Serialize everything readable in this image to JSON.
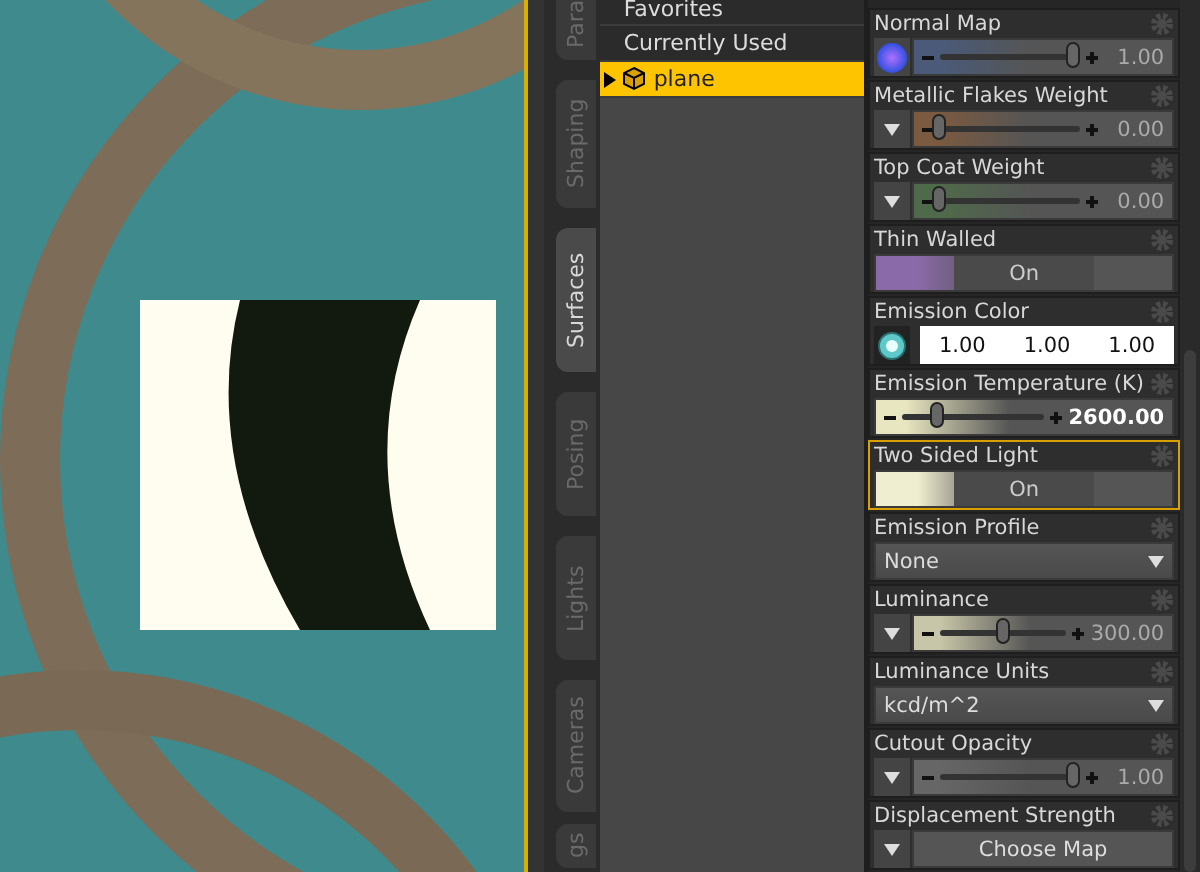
{
  "side_tabs": [
    {
      "label": "Para",
      "selected": false
    },
    {
      "label": "Shaping",
      "selected": false
    },
    {
      "label": "Surfaces",
      "selected": true
    },
    {
      "label": "Posing",
      "selected": false
    },
    {
      "label": "Lights",
      "selected": false
    },
    {
      "label": "Cameras",
      "selected": false
    },
    {
      "label": "gs",
      "selected": false
    }
  ],
  "tree": [
    {
      "kind": "category",
      "label": "Favorites",
      "selected": false
    },
    {
      "kind": "category",
      "label": "Currently Used",
      "selected": false
    },
    {
      "kind": "object",
      "label": "plane",
      "selected": true
    }
  ],
  "properties": [
    {
      "kind": "mapslider",
      "label": "Normal Map",
      "color": "#4a5a78",
      "level": 0.95,
      "reading": "1.00",
      "selected": false
    },
    {
      "kind": "menuslider",
      "label": "Metallic Flakes Weight",
      "color": "#7a5a40",
      "level": 0.0,
      "reading": "0.00",
      "selected": false
    },
    {
      "kind": "menuslider",
      "label": "Top Coat Weight",
      "color": "#4f6a4a",
      "level": 0.0,
      "reading": "0.00",
      "selected": false
    },
    {
      "kind": "toggle",
      "label": "Thin Walled",
      "color": "#8a6aa8",
      "value": "On",
      "selected": false
    },
    {
      "kind": "color",
      "label": "Emission Color",
      "values": [
        "1.00",
        "1.00",
        "1.00"
      ],
      "selected": false
    },
    {
      "kind": "slider",
      "label": "Emission Temperature (K)",
      "color": "#e8e6c0",
      "level": 0.25,
      "reading": "2600.00",
      "selected": false
    },
    {
      "kind": "toggle",
      "label": "Two Sided Light",
      "color": "#f0eed0",
      "value": "On",
      "selected": true
    },
    {
      "kind": "dropdown",
      "label": "Emission Profile",
      "value": "None",
      "selected": false
    },
    {
      "kind": "menuslider",
      "label": "Luminance",
      "color": "#c8c6a8",
      "level": 0.5,
      "reading": "300.00",
      "selected": false
    },
    {
      "kind": "dropdown",
      "label": "Luminance Units",
      "value": "kcd/m^2",
      "selected": false
    },
    {
      "kind": "menuslider",
      "label": "Cutout Opacity",
      "color": "#666666",
      "level": 0.95,
      "reading": "1.00",
      "selected": false
    },
    {
      "kind": "mapbutton",
      "label": "Displacement Strength",
      "value": "Choose Map",
      "selected": false
    }
  ]
}
